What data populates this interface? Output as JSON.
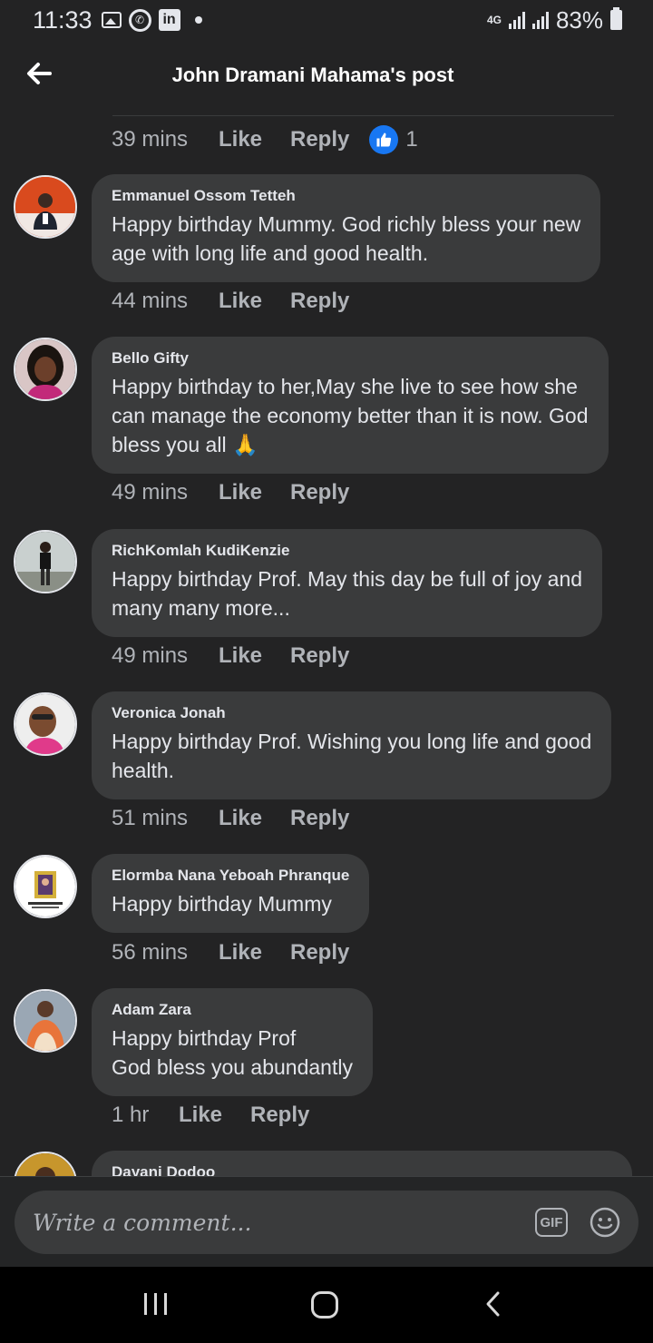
{
  "status_bar": {
    "time": "11:33",
    "network": "4G",
    "battery": "83%"
  },
  "header": {
    "title": "John Dramani Mahama's post"
  },
  "top_meta": {
    "time": "39 mins",
    "like_label": "Like",
    "reply_label": "Reply",
    "reaction_count": "1"
  },
  "comments": [
    {
      "name": "Emmanuel Ossom Tetteh",
      "text": "Happy birthday Mummy. God richly bless your new\nage with long life and good health.",
      "time": "44 mins",
      "like_label": "Like",
      "reply_label": "Reply"
    },
    {
      "name": "Bello Gifty",
      "text": "Happy birthday to her,May she live to see how she\ncan manage the economy better than it is now. God\nbless you all 🙏",
      "time": "49 mins",
      "like_label": "Like",
      "reply_label": "Reply"
    },
    {
      "name": "RichKomlah KudiKenzie",
      "text": "Happy birthday Prof. May this day be full of joy and\nmany many more...",
      "time": "49 mins",
      "like_label": "Like",
      "reply_label": "Reply"
    },
    {
      "name": "Veronica Jonah",
      "text": "Happy birthday Prof. Wishing you long life and good\nhealth.",
      "time": "51 mins",
      "like_label": "Like",
      "reply_label": "Reply"
    },
    {
      "name": "Elormba Nana Yeboah Phranque",
      "text": "Happy birthday Mummy",
      "time": "56 mins",
      "like_label": "Like",
      "reply_label": "Reply"
    },
    {
      "name": "Adam Zara",
      "text": "Happy birthday Prof\nGod bless you abundantly",
      "time": "1 hr",
      "like_label": "Like",
      "reply_label": "Reply"
    },
    {
      "name": "Dayani Dodoo"
    }
  ],
  "composer": {
    "placeholder": "Write a comment...",
    "gif_label": "GIF"
  },
  "colors": {
    "background": "#232324",
    "bubble": "#3a3b3c",
    "like_blue": "#1877f2",
    "text": "#e4e6eb",
    "secondary": "#b0b3b8"
  }
}
